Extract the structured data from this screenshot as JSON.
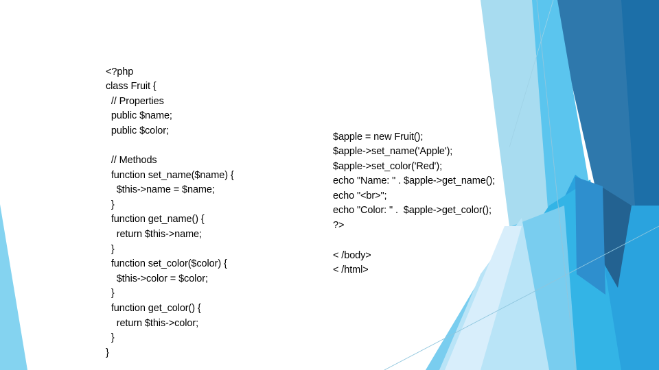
{
  "slide": {
    "background_color": "#ffffff",
    "text_color": "#000000",
    "accent_colors": {
      "pale_blue": "#d8eefb",
      "light_blue": "#a8dcf0",
      "sky_blue": "#5bc5ee",
      "bright_blue": "#2aa3de",
      "mid_blue": "#2e8fce",
      "steel_blue": "#2e78ac",
      "deep_blue": "#1c6fa8",
      "darkest_blue": "#236291",
      "hairline": "#7fb8d4"
    }
  },
  "code_left": {
    "label": "php-class-definition",
    "text": "<?php\nclass Fruit {\n  // Properties\n  public $name;\n  public $color;\n\n  // Methods\n  function set_name($name) {\n    $this->name = $name;\n  }\n  function get_name() {\n    return $this->name;\n  }\n  function set_color($color) {\n    $this->color = $color;\n  }\n  function get_color() {\n    return $this->color;\n  }\n}",
    "lines": [
      "<?php",
      "class Fruit {",
      "  // Properties",
      "  public $name;",
      "  public $color;",
      "",
      "  // Methods",
      "  function set_name($name) {",
      "    $this->name = $name;",
      "  }",
      "  function get_name() {",
      "    return $this->name;",
      "  }",
      "  function set_color($color) {",
      "    $this->color = $color;",
      "  }",
      "  function get_color() {",
      "    return $this->color;",
      "  }",
      "}"
    ]
  },
  "code_right": {
    "label": "php-object-usage",
    "text": "$apple = new Fruit();\n$apple->set_name('Apple');\n$apple->set_color('Red');\necho \"Name: \" . $apple->get_name();\necho \"<br>\";\necho \"Color: \" .  $apple->get_color();\n?>",
    "lines": [
      "$apple = new Fruit();",
      "$apple->set_name('Apple');",
      "$apple->set_color('Red');",
      "echo \"Name: \" . $apple->get_name();",
      "echo \"<br>\";",
      "echo \"Color: \" .  $apple->get_color();",
      "?>"
    ]
  },
  "code_right_tail": {
    "label": "html-closing-tags",
    "text": "< /body>\n< /html>",
    "lines": [
      "< /body>",
      "< /html>"
    ]
  }
}
